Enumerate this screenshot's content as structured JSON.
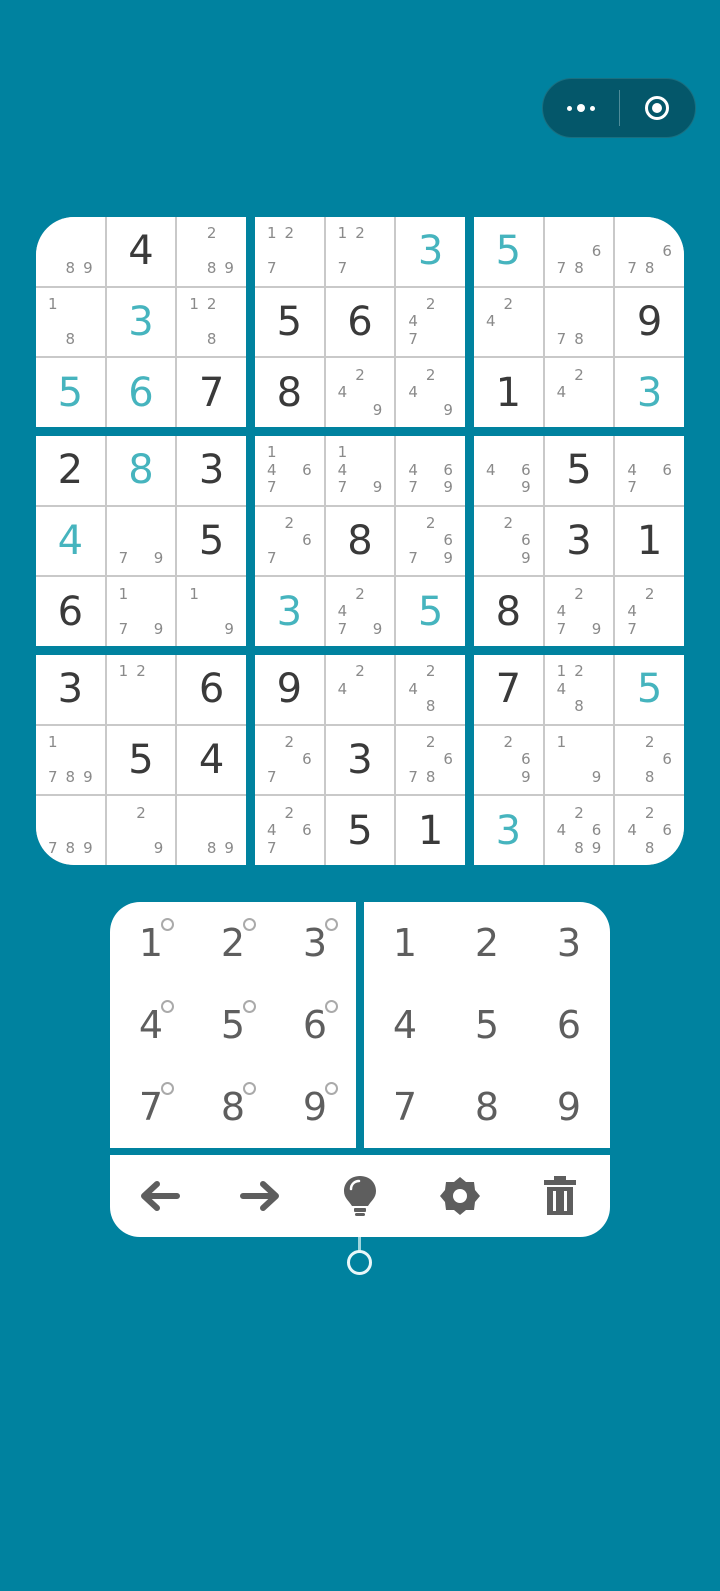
{
  "capsule": {
    "menu_icon": "more-dots-icon",
    "close_icon": "target-icon"
  },
  "colors": {
    "background": "#00829f",
    "given_digit": "#46b4be",
    "filled_digit": "#3a3a3a",
    "candidate": "#8a8a8a"
  },
  "board": {
    "cells": [
      [
        {
          "v": "",
          "c": [
            "8",
            "9"
          ]
        },
        {
          "v": "4",
          "g": false
        },
        {
          "v": "",
          "c": [
            "2",
            "8",
            "9"
          ]
        },
        {
          "v": "",
          "c": [
            "1",
            "2",
            "7"
          ]
        },
        {
          "v": "",
          "c": [
            "1",
            "2",
            "7"
          ]
        },
        {
          "v": "3",
          "g": true
        },
        {
          "v": "5",
          "g": true
        },
        {
          "v": "",
          "c": [
            "6",
            "7",
            "8"
          ]
        },
        {
          "v": "",
          "c": [
            "6",
            "7",
            "8"
          ]
        }
      ],
      [
        {
          "v": "",
          "c": [
            "1",
            "8"
          ]
        },
        {
          "v": "3",
          "g": true
        },
        {
          "v": "",
          "c": [
            "1",
            "2",
            "8"
          ]
        },
        {
          "v": "5",
          "g": false
        },
        {
          "v": "6",
          "g": false
        },
        {
          "v": "",
          "c": [
            "2",
            "4",
            "7"
          ]
        },
        {
          "v": "",
          "c": [
            "2",
            "4"
          ]
        },
        {
          "v": "",
          "c": [
            "7",
            "8"
          ]
        },
        {
          "v": "9",
          "g": false
        }
      ],
      [
        {
          "v": "5",
          "g": true
        },
        {
          "v": "6",
          "g": true
        },
        {
          "v": "7",
          "g": false
        },
        {
          "v": "8",
          "g": false
        },
        {
          "v": "",
          "c": [
            "2",
            "4",
            "9"
          ]
        },
        {
          "v": "",
          "c": [
            "2",
            "4",
            "9"
          ]
        },
        {
          "v": "1",
          "g": false
        },
        {
          "v": "",
          "c": [
            "2",
            "4"
          ]
        },
        {
          "v": "3",
          "g": true
        }
      ],
      [
        {
          "v": "2",
          "g": false
        },
        {
          "v": "8",
          "g": true
        },
        {
          "v": "3",
          "g": false
        },
        {
          "v": "",
          "c": [
            "1",
            "4",
            "6",
            "7"
          ]
        },
        {
          "v": "",
          "c": [
            "1",
            "4",
            "7",
            "9"
          ]
        },
        {
          "v": "",
          "c": [
            "4",
            "6",
            "7",
            "9"
          ]
        },
        {
          "v": "",
          "c": [
            "4",
            "6",
            "9"
          ]
        },
        {
          "v": "5",
          "g": false
        },
        {
          "v": "",
          "c": [
            "4",
            "6",
            "7"
          ]
        }
      ],
      [
        {
          "v": "4",
          "g": true
        },
        {
          "v": "",
          "c": [
            "7",
            "9"
          ]
        },
        {
          "v": "5",
          "g": false
        },
        {
          "v": "",
          "c": [
            "2",
            "6",
            "7"
          ]
        },
        {
          "v": "8",
          "g": false
        },
        {
          "v": "",
          "c": [
            "2",
            "6",
            "7",
            "9"
          ]
        },
        {
          "v": "",
          "c": [
            "2",
            "6",
            "9"
          ]
        },
        {
          "v": "3",
          "g": false
        },
        {
          "v": "1",
          "g": false
        }
      ],
      [
        {
          "v": "6",
          "g": false
        },
        {
          "v": "",
          "c": [
            "1",
            "7",
            "9"
          ]
        },
        {
          "v": "",
          "c": [
            "1",
            "9"
          ]
        },
        {
          "v": "3",
          "g": true
        },
        {
          "v": "",
          "c": [
            "2",
            "4",
            "7",
            "9"
          ]
        },
        {
          "v": "5",
          "g": true
        },
        {
          "v": "8",
          "g": false
        },
        {
          "v": "",
          "c": [
            "2",
            "4",
            "7",
            "9"
          ]
        },
        {
          "v": "",
          "c": [
            "2",
            "4",
            "7"
          ]
        }
      ],
      [
        {
          "v": "3",
          "g": false
        },
        {
          "v": "",
          "c": [
            "1",
            "2"
          ]
        },
        {
          "v": "6",
          "g": false
        },
        {
          "v": "9",
          "g": false
        },
        {
          "v": "",
          "c": [
            "2",
            "4"
          ]
        },
        {
          "v": "",
          "c": [
            "2",
            "4",
            "8"
          ]
        },
        {
          "v": "7",
          "g": false
        },
        {
          "v": "",
          "c": [
            "1",
            "2",
            "4",
            "8"
          ]
        },
        {
          "v": "5",
          "g": true
        }
      ],
      [
        {
          "v": "",
          "c": [
            "1",
            "7",
            "8",
            "9"
          ]
        },
        {
          "v": "5",
          "g": false
        },
        {
          "v": "4",
          "g": false
        },
        {
          "v": "",
          "c": [
            "2",
            "6",
            "7"
          ]
        },
        {
          "v": "3",
          "g": false
        },
        {
          "v": "",
          "c": [
            "2",
            "6",
            "7",
            "8"
          ]
        },
        {
          "v": "",
          "c": [
            "2",
            "6",
            "9"
          ]
        },
        {
          "v": "",
          "c": [
            "1",
            "9"
          ]
        },
        {
          "v": "",
          "c": [
            "2",
            "6",
            "8"
          ]
        }
      ],
      [
        {
          "v": "",
          "c": [
            "7",
            "8",
            "9"
          ]
        },
        {
          "v": "",
          "c": [
            "2",
            "9"
          ]
        },
        {
          "v": "",
          "c": [
            "8",
            "9"
          ]
        },
        {
          "v": "",
          "c": [
            "2",
            "4",
            "6",
            "7"
          ]
        },
        {
          "v": "5",
          "g": false
        },
        {
          "v": "1",
          "g": false
        },
        {
          "v": "3",
          "g": true
        },
        {
          "v": "",
          "c": [
            "2",
            "4",
            "6",
            "8",
            "9"
          ]
        },
        {
          "v": "",
          "c": [
            "2",
            "4",
            "6",
            "8"
          ]
        }
      ]
    ]
  },
  "note_pad": {
    "keys": [
      "1",
      "2",
      "3",
      "4",
      "5",
      "6",
      "7",
      "8",
      "9"
    ]
  },
  "number_pad": {
    "keys": [
      "1",
      "2",
      "3",
      "4",
      "5",
      "6",
      "7",
      "8",
      "9"
    ]
  },
  "toolbar": {
    "icons": [
      "arrow-left-icon",
      "arrow-right-icon",
      "lightbulb-icon",
      "gear-icon",
      "trash-icon"
    ]
  }
}
